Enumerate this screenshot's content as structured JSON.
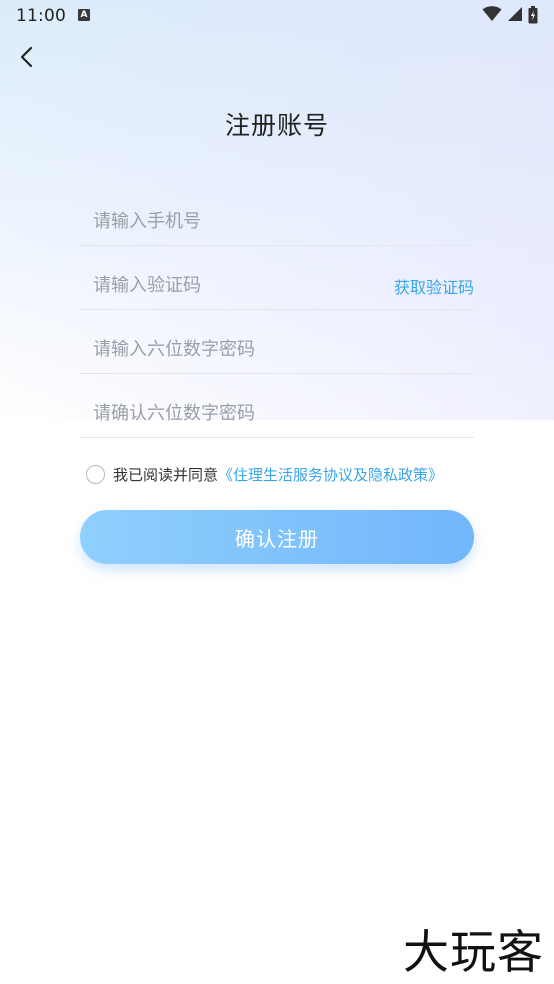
{
  "status_bar": {
    "time": "11:00",
    "notification_icon": "A"
  },
  "header": {
    "back_icon": "chevron-left-icon",
    "title": "注册账号"
  },
  "form": {
    "phone_placeholder": "请输入手机号",
    "code_placeholder": "请输入验证码",
    "get_code_label": "获取验证码",
    "password_placeholder": "请输入六位数字密码",
    "confirm_password_placeholder": "请确认六位数字密码"
  },
  "agreement": {
    "prefix": "我已阅读并同意",
    "link": "《住理生活服务协议及隐私政策》",
    "checked": false
  },
  "submit": {
    "label": "确认注册"
  },
  "watermark": {
    "text": "大玩客"
  },
  "colors": {
    "accent_link": "#3aa6e8",
    "button_gradient_start": "#8fd0fd",
    "button_gradient_end": "#71b6fb"
  }
}
